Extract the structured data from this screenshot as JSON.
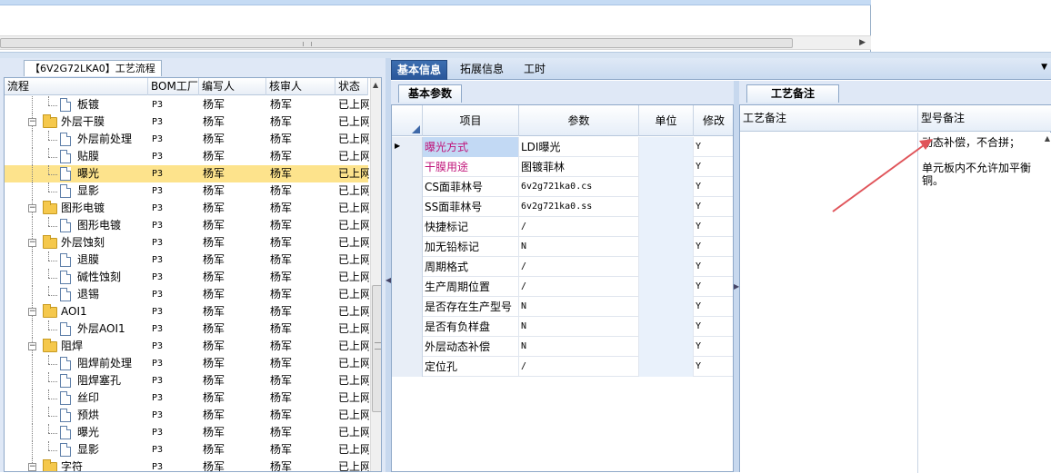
{
  "left_panel": {
    "tab_label": "【6V2G72LKA0】工艺流程",
    "columns": [
      "流程",
      "BOM工厂",
      "编写人",
      "核审人",
      "状态"
    ],
    "rows": [
      {
        "name": "板镀",
        "level": 2,
        "type": "leaf",
        "factory": "P3",
        "writer": "杨军",
        "reviewer": "杨军",
        "status": "已上网"
      },
      {
        "name": "外层干膜",
        "level": 1,
        "type": "folder",
        "factory": "P3",
        "writer": "杨军",
        "reviewer": "杨军",
        "status": "已上网"
      },
      {
        "name": "外层前处理",
        "level": 2,
        "type": "leaf",
        "factory": "P3",
        "writer": "杨军",
        "reviewer": "杨军",
        "status": "已上网"
      },
      {
        "name": "贴膜",
        "level": 2,
        "type": "leaf",
        "factory": "P3",
        "writer": "杨军",
        "reviewer": "杨军",
        "status": "已上网"
      },
      {
        "name": "曝光",
        "level": 2,
        "type": "leaf",
        "factory": "P3",
        "writer": "杨军",
        "reviewer": "杨军",
        "status": "已上网",
        "selected": true
      },
      {
        "name": "显影",
        "level": 2,
        "type": "leaf",
        "factory": "P3",
        "writer": "杨军",
        "reviewer": "杨军",
        "status": "已上网"
      },
      {
        "name": "图形电镀",
        "level": 1,
        "type": "folder",
        "factory": "P3",
        "writer": "杨军",
        "reviewer": "杨军",
        "status": "已上网"
      },
      {
        "name": "图形电镀",
        "level": 2,
        "type": "leaf",
        "factory": "P3",
        "writer": "杨军",
        "reviewer": "杨军",
        "status": "已上网"
      },
      {
        "name": "外层蚀刻",
        "level": 1,
        "type": "folder",
        "factory": "P3",
        "writer": "杨军",
        "reviewer": "杨军",
        "status": "已上网"
      },
      {
        "name": "退膜",
        "level": 2,
        "type": "leaf",
        "factory": "P3",
        "writer": "杨军",
        "reviewer": "杨军",
        "status": "已上网"
      },
      {
        "name": "碱性蚀刻",
        "level": 2,
        "type": "leaf",
        "factory": "P3",
        "writer": "杨军",
        "reviewer": "杨军",
        "status": "已上网"
      },
      {
        "name": "退锡",
        "level": 2,
        "type": "leaf",
        "factory": "P3",
        "writer": "杨军",
        "reviewer": "杨军",
        "status": "已上网"
      },
      {
        "name": "AOI1",
        "level": 1,
        "type": "folder",
        "factory": "P3",
        "writer": "杨军",
        "reviewer": "杨军",
        "status": "已上网"
      },
      {
        "name": "外层AOI1",
        "level": 2,
        "type": "leaf",
        "factory": "P3",
        "writer": "杨军",
        "reviewer": "杨军",
        "status": "已上网"
      },
      {
        "name": "阻焊",
        "level": 1,
        "type": "folder",
        "factory": "P3",
        "writer": "杨军",
        "reviewer": "杨军",
        "status": "已上网"
      },
      {
        "name": "阻焊前处理",
        "level": 2,
        "type": "leaf",
        "factory": "P3",
        "writer": "杨军",
        "reviewer": "杨军",
        "status": "已上网"
      },
      {
        "name": "阻焊塞孔",
        "level": 2,
        "type": "leaf",
        "factory": "P3",
        "writer": "杨军",
        "reviewer": "杨军",
        "status": "已上网"
      },
      {
        "name": "丝印",
        "level": 2,
        "type": "leaf",
        "factory": "P3",
        "writer": "杨军",
        "reviewer": "杨军",
        "status": "已上网"
      },
      {
        "name": "预烘",
        "level": 2,
        "type": "leaf",
        "factory": "P3",
        "writer": "杨军",
        "reviewer": "杨军",
        "status": "已上网"
      },
      {
        "name": "曝光",
        "level": 2,
        "type": "leaf",
        "factory": "P3",
        "writer": "杨军",
        "reviewer": "杨军",
        "status": "已上网"
      },
      {
        "name": "显影",
        "level": 2,
        "type": "leaf",
        "factory": "P3",
        "writer": "杨军",
        "reviewer": "杨军",
        "status": "已上网"
      },
      {
        "name": "字符",
        "level": 1,
        "type": "folder",
        "factory": "P3",
        "writer": "杨军",
        "reviewer": "杨军",
        "status": "已上网"
      }
    ]
  },
  "main_tabs": [
    "基本信息",
    "拓展信息",
    "工时"
  ],
  "center_panel": {
    "sub_tab": "基本参数",
    "columns": [
      "项目",
      "参数",
      "单位",
      "修改"
    ],
    "rows": [
      {
        "item": "曝光方式",
        "value": "LDI曝光",
        "unit": "",
        "modify": "Y",
        "magenta": true,
        "current": true
      },
      {
        "item": "干膜用途",
        "value": "图镀菲林",
        "unit": "",
        "modify": "Y",
        "magenta": true
      },
      {
        "item": "CS面菲林号",
        "value": "6v2g721ka0.cs",
        "unit": "",
        "modify": "Y"
      },
      {
        "item": "SS面菲林号",
        "value": "6v2g721ka0.ss",
        "unit": "",
        "modify": "Y"
      },
      {
        "item": "快捷标记",
        "value": "/",
        "unit": "",
        "modify": "Y"
      },
      {
        "item": "加无铅标记",
        "value": "N",
        "unit": "",
        "modify": "Y"
      },
      {
        "item": "周期格式",
        "value": "/",
        "unit": "",
        "modify": "Y"
      },
      {
        "item": "生产周期位置",
        "value": "/",
        "unit": "",
        "modify": "Y"
      },
      {
        "item": "是否存在生产型号",
        "value": "N",
        "unit": "",
        "modify": "Y"
      },
      {
        "item": "是否有负样盘",
        "value": "N",
        "unit": "",
        "modify": "Y"
      },
      {
        "item": "外层动态补偿",
        "value": "N",
        "unit": "",
        "modify": "Y"
      },
      {
        "item": "定位孔",
        "value": "/",
        "unit": "",
        "modify": "Y"
      }
    ]
  },
  "right_panel": {
    "tab": "工艺备注",
    "columns": [
      "工艺备注",
      "型号备注"
    ],
    "model_note": "动态补偿，不合拼；\n\n单元板内不允许加平衡铜。"
  },
  "colors": {
    "selected_row": "#fde38c",
    "active_tab": "#2a5699",
    "magenta_text": "#c0147a",
    "annotation_arrow": "#e0545a"
  }
}
